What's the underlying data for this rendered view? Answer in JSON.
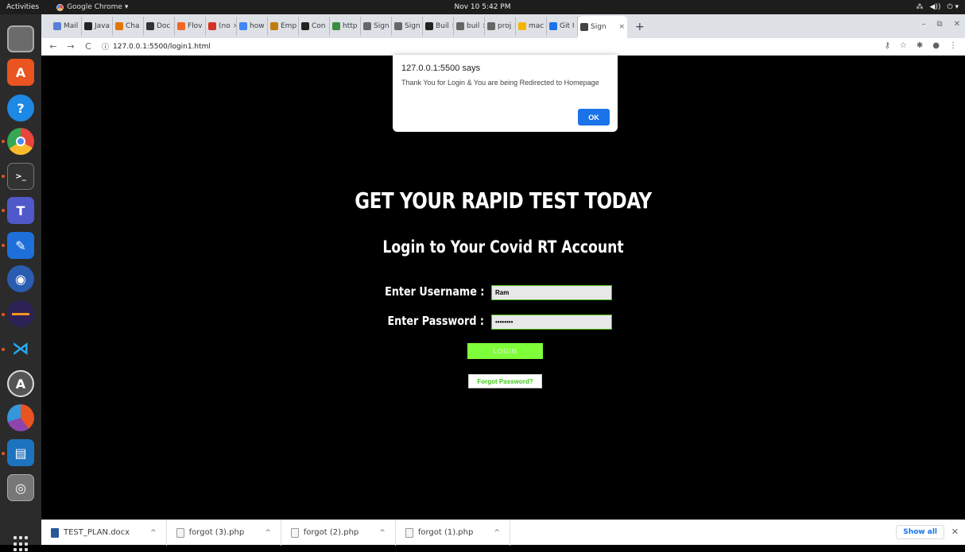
{
  "topbar": {
    "activities": "Activities",
    "app_name": "Google Chrome ▾",
    "clock": "Nov 10  5:42 PM"
  },
  "browser": {
    "tabs": [
      {
        "label": "Mail",
        "color": "#5b7fd8"
      },
      {
        "label": "Java",
        "color": "#222222"
      },
      {
        "label": "Cha",
        "color": "#e37400"
      },
      {
        "label": "Doc",
        "color": "#333333"
      },
      {
        "label": "Flov",
        "color": "#f26522"
      },
      {
        "label": "(no",
        "color": "#d93025"
      },
      {
        "label": "how",
        "color": "#4285f4"
      },
      {
        "label": "Emp",
        "color": "#c27c0e"
      },
      {
        "label": "Con",
        "color": "#222222"
      },
      {
        "label": "http",
        "color": "#3c8c40"
      },
      {
        "label": "Sign",
        "color": "#666666"
      },
      {
        "label": "Sign",
        "color": "#666666"
      },
      {
        "label": "Buil",
        "color": "#222222"
      },
      {
        "label": "buil",
        "color": "#666666"
      },
      {
        "label": "proj",
        "color": "#666666"
      },
      {
        "label": "mac",
        "color": "#f4b400"
      },
      {
        "label": "Git I",
        "color": "#1a73e8"
      },
      {
        "label": "Sign",
        "color": "#444444",
        "active": true
      }
    ],
    "new_tab": "+",
    "url": "127.0.0.1:5500/login1.html"
  },
  "alert": {
    "origin": "127.0.0.1:5500 says",
    "message": "Thank You for Login & You are being Redirected to Homepage",
    "ok_label": "OK"
  },
  "page": {
    "headline": "GET YOUR RAPID TEST TODAY",
    "subhead": "Login to Your Covid RT Account",
    "username_label": "Enter Username :",
    "username_value": "Ram",
    "password_label": "Enter Password :",
    "password_value": "••••••••",
    "login_button": "LOGIN",
    "forgot_button": "Forgot Password?"
  },
  "downloads": {
    "items": [
      "TEST_PLAN.docx",
      "forgot (3).php",
      "forgot (2).php",
      "forgot (1).php"
    ],
    "show_all": "Show all"
  },
  "colors": {
    "accent_green": "#7fff3a",
    "field_border": "#4cbb17",
    "dialog_button": "#1a73e8"
  }
}
